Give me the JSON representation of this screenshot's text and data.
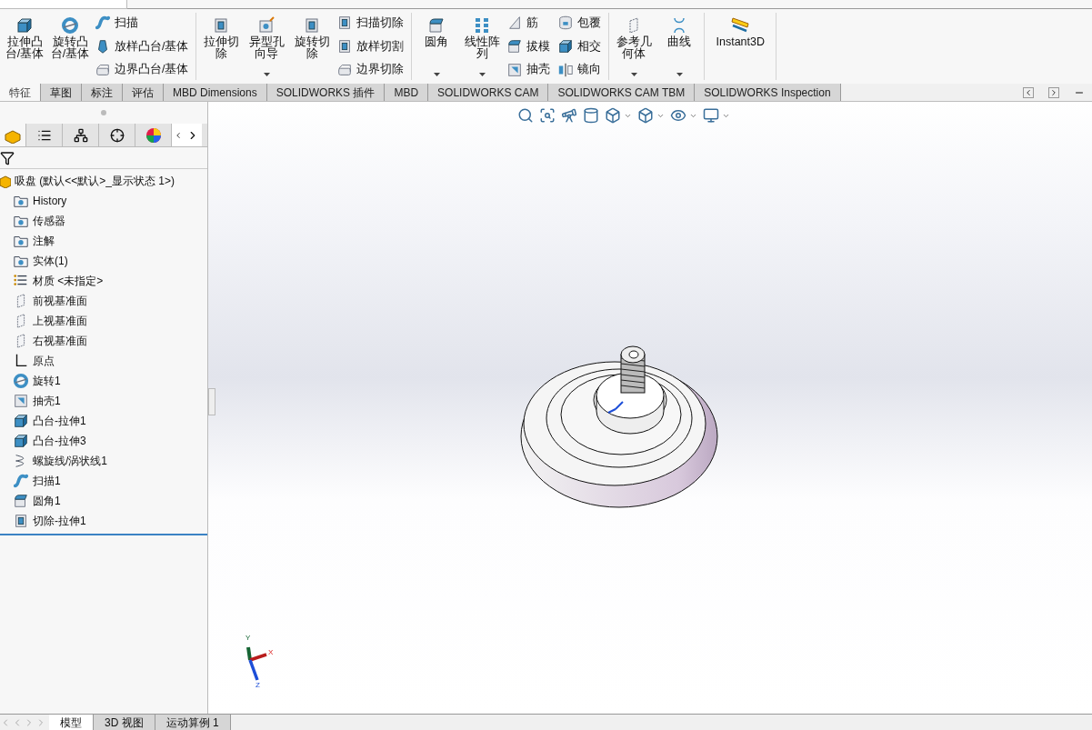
{
  "ribbon": {
    "groups": [
      {
        "large": [
          {
            "label": "拉伸凸台/基体",
            "kind": "extrude",
            "dropdown": false
          },
          {
            "label": "旋转凸台/基体",
            "kind": "revolve",
            "dropdown": false
          }
        ],
        "small_columns": [
          [
            {
              "label": "扫描",
              "kind": "sweep"
            },
            {
              "label": "放样凸台/基体",
              "kind": "loft"
            },
            {
              "label": "边界凸台/基体",
              "kind": "boundary"
            }
          ]
        ]
      },
      {
        "large": [
          {
            "label": "拉伸切除",
            "kind": "cut",
            "dropdown": false
          },
          {
            "label": "异型孔向导",
            "kind": "hole",
            "dropdown": true
          },
          {
            "label": "旋转切除",
            "kind": "cut",
            "dropdown": false
          }
        ],
        "small_columns": [
          [
            {
              "label": "扫描切除",
              "kind": "cut"
            },
            {
              "label": "放样切割",
              "kind": "cut"
            },
            {
              "label": "边界切除",
              "kind": "boundary"
            }
          ]
        ]
      },
      {
        "large": [
          {
            "label": "圆角",
            "kind": "fillet",
            "dropdown": true
          },
          {
            "label": "线性阵列",
            "kind": "pattern",
            "dropdown": true
          }
        ],
        "small_columns": [
          [
            {
              "label": "筋",
              "kind": "rib"
            },
            {
              "label": "拔模",
              "kind": "fillet"
            },
            {
              "label": "抽壳",
              "kind": "shell"
            }
          ],
          [
            {
              "label": "包覆",
              "kind": "wrap"
            },
            {
              "label": "相交",
              "kind": "extrude"
            },
            {
              "label": "镜向",
              "kind": "mirror"
            }
          ]
        ]
      },
      {
        "large": [
          {
            "label": "参考几何体",
            "kind": "plane",
            "dropdown": true
          },
          {
            "label": "曲线",
            "kind": "curve",
            "dropdown": true
          }
        ]
      },
      {
        "large": [
          {
            "label": "Instant3D",
            "kind": "ruler",
            "dropdown": false
          }
        ]
      }
    ]
  },
  "command_tabs": [
    {
      "label": "特征",
      "selected": true
    },
    {
      "label": "草图",
      "selected": false
    },
    {
      "label": "标注",
      "selected": false
    },
    {
      "label": "评估",
      "selected": false
    },
    {
      "label": "MBD Dimensions",
      "selected": false
    },
    {
      "label": "SOLIDWORKS 插件",
      "selected": false
    },
    {
      "label": "MBD",
      "selected": false
    },
    {
      "label": "SOLIDWORKS CAM",
      "selected": false
    },
    {
      "label": "SOLIDWORKS CAM TBM",
      "selected": false
    },
    {
      "label": "SOLIDWORKS Inspection",
      "selected": false
    }
  ],
  "feature_tree": {
    "label": "吸盘 (默认<<默认>_显示状态 1>)",
    "children": [
      {
        "label": "History",
        "kind": "folder"
      },
      {
        "label": "传感器",
        "kind": "folder"
      },
      {
        "label": "注解",
        "kind": "folder"
      },
      {
        "label": "实体(1)",
        "kind": "folder"
      },
      {
        "label": "材质 <未指定>",
        "kind": "material"
      },
      {
        "label": "前视基准面",
        "kind": "plane"
      },
      {
        "label": "上视基准面",
        "kind": "plane"
      },
      {
        "label": "右视基准面",
        "kind": "plane"
      },
      {
        "label": "原点",
        "kind": "origin"
      },
      {
        "label": "旋转1",
        "kind": "revolve"
      },
      {
        "label": "抽壳1",
        "kind": "shell"
      },
      {
        "label": "凸台-拉伸1",
        "kind": "extrude"
      },
      {
        "label": "凸台-拉伸3",
        "kind": "extrude"
      },
      {
        "label": "螺旋线/涡状线1",
        "kind": "helix"
      },
      {
        "label": "扫描1",
        "kind": "sweep"
      },
      {
        "label": "圆角1",
        "kind": "fillet"
      },
      {
        "label": "切除-拉伸1",
        "kind": "cut"
      }
    ]
  },
  "triad": {
    "x": "X",
    "y": "Y",
    "z": "Z"
  },
  "view_tabs": [
    {
      "label": "模型",
      "selected": true
    },
    {
      "label": "3D 视图",
      "selected": false
    },
    {
      "label": "运动算例 1",
      "selected": false
    }
  ]
}
